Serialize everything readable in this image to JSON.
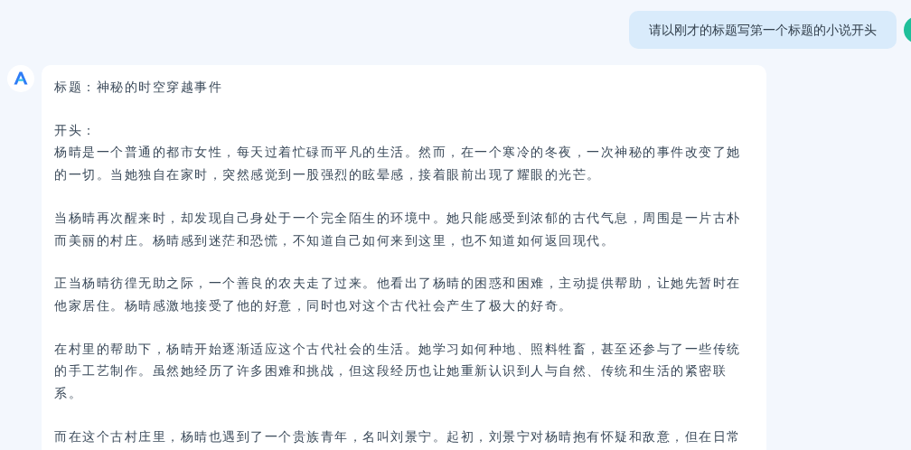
{
  "user_message": {
    "text": "请以刚才的标题写第一个标题的小说开头"
  },
  "assistant_message": {
    "paragraphs": [
      {
        "lines": [
          "标题：神秘的时空穿越事件"
        ]
      },
      {
        "lines": [
          "开头：",
          "杨晴是一个普通的都市女性，每天过着忙碌而平凡的生活。然而，在一个寒冷的冬夜，一次神秘的事件改变了她的一切。当她独自在家时，突然感觉到一股强烈的眩晕感，接着眼前出现了耀眼的光芒。"
        ]
      },
      {
        "lines": [
          "当杨晴再次醒来时，却发现自己身处于一个完全陌生的环境中。她只能感受到浓郁的古代气息，周围是一片古朴而美丽的村庄。杨晴感到迷茫和恐慌，不知道自己如何来到这里，也不知道如何返回现代。"
        ]
      },
      {
        "lines": [
          "正当杨晴彷徨无助之际，一个善良的农夫走了过来。他看出了杨晴的困惑和困难，主动提供帮助，让她先暂时在他家居住。杨晴感激地接受了他的好意，同时也对这个古代社会产生了极大的好奇。"
        ]
      },
      {
        "lines": [
          "在村里的帮助下，杨晴开始逐渐适应这个古代社会的生活。她学习如何种地、照料牲畜，甚至还参与了一些传统的手工艺制作。虽然她经历了许多困难和挑战，但这段经历也让她重新认识到人与自然、传统和生活的紧密联系。"
        ]
      },
      {
        "lines": [
          "而在这个古村庄里，杨晴也遇到了一个贵族青年，名叫刘景宁。起初，刘景宁对杨晴抱有怀疑和敌意，但在日常"
        ]
      }
    ]
  }
}
